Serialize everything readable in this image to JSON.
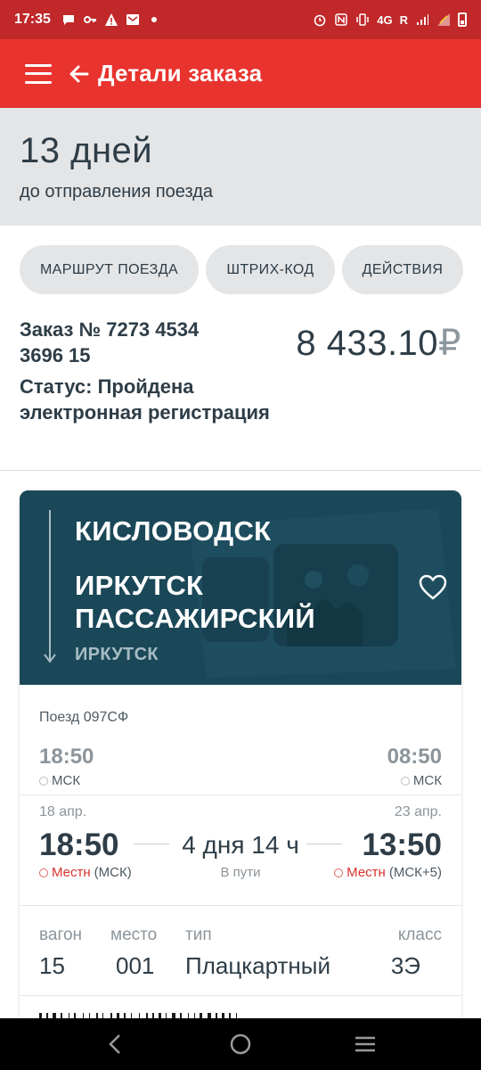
{
  "status_bar": {
    "time": "17:35",
    "network": "4G",
    "roaming": "R"
  },
  "app_bar": {
    "title": "Детали заказа",
    "menu_icon": "hamburger-menu-icon",
    "back_icon": "arrow-left-icon"
  },
  "countdown": {
    "days": "13 дней",
    "subtitle": "до отправления поезда"
  },
  "actions": [
    {
      "label": "МАРШРУТ ПОЕЗДА"
    },
    {
      "label": "ШТРИХ-КОД"
    },
    {
      "label": "ДЕЙСТВИЯ"
    }
  ],
  "order": {
    "number_line1": "Заказ № 7273 4534",
    "number_line2": "3696 15",
    "status": "Статус: Пройдена электронная регистрация",
    "price": "8 433.10",
    "currency": "₽"
  },
  "trip": {
    "from": "КИСЛОВОДСК",
    "to": "ИРКУТСК ПАССАЖИРСКИЙ",
    "to_city": "ИРКУТСК",
    "train": "Поезд 097СФ",
    "msk_departure": "18:50",
    "msk_arrival": "08:50",
    "msk_label": "МСК",
    "dep_date": "18 апр.",
    "arr_date": "23 апр.",
    "dep_time": "18:50",
    "arr_time": "13:50",
    "duration": "4 дня 14 ч",
    "en_route": "В пути",
    "local_label": "Местн",
    "dep_tz": "(МСК)",
    "arr_tz": "(МСК+5)",
    "seat": {
      "car_label": "вагон",
      "car": "15",
      "seat_label": "место",
      "seat": "001",
      "type_label": "тип",
      "type": "Плацкартный",
      "class_label": "класс",
      "class": "3Э"
    }
  },
  "colors": {
    "status_bar": "#c0282a",
    "app_bar": "#e8332e",
    "hero": "#1e4c5c",
    "local_time": "#d9322d"
  }
}
